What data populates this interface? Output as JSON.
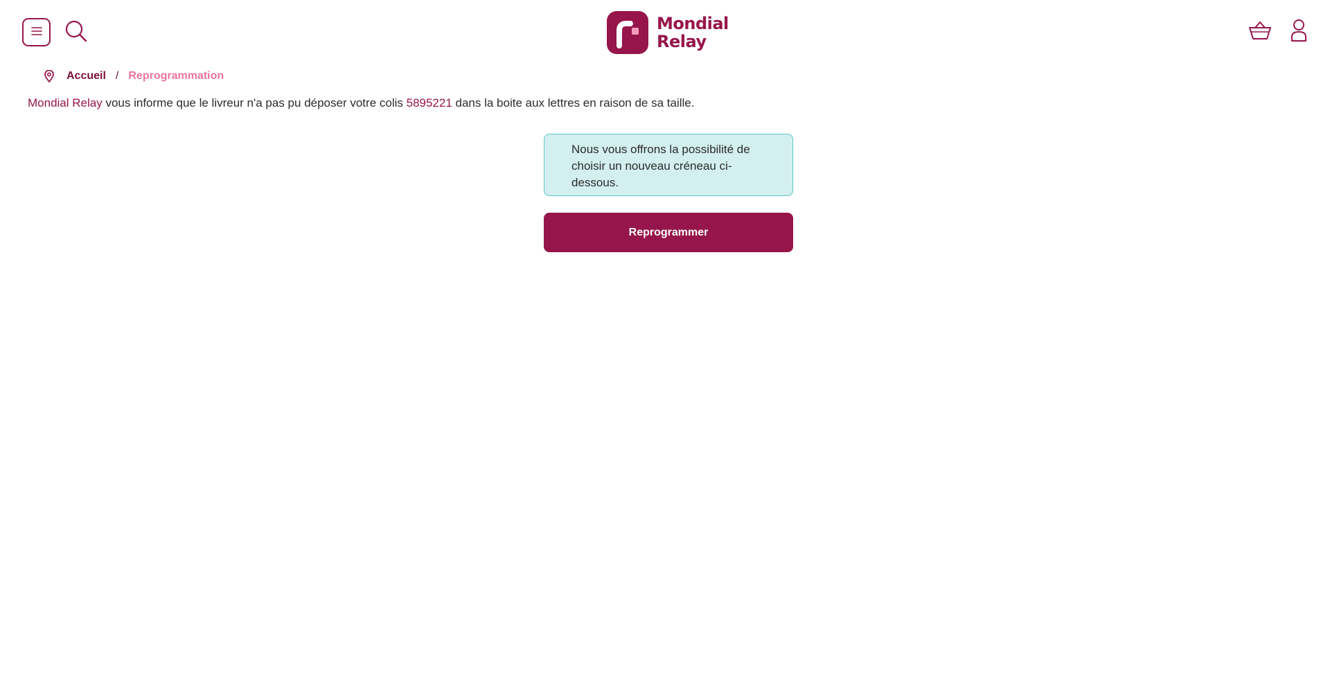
{
  "header": {
    "menu_icon": "hamburger-icon",
    "search_icon": "search-icon",
    "logo": {
      "line1": "Mondial",
      "line2": "Relay"
    },
    "cart_icon": "basket-icon",
    "account_icon": "user-icon"
  },
  "breadcrumb": {
    "icon": "location-pin-icon",
    "home": "Accueil",
    "separator": "/",
    "current": "Reprogrammation"
  },
  "info": {
    "brand": "Mondial Relay",
    "text_before_number": " vous informe que le livreur n'a pas pu déposer votre colis ",
    "parcel_number": "5895221",
    "text_after_number": " dans la boite aux lettres en raison de sa taille."
  },
  "notice": {
    "text": "Nous vous offrons la possibilité de choisir un nouveau créneau ci-dessous."
  },
  "actions": {
    "reprogram_label": "Reprogrammer"
  },
  "colors": {
    "brand": "#96154a",
    "breadcrumb_current": "#e8749a",
    "notice_background": "#d3efef",
    "notice_border": "#5cc7c6"
  }
}
